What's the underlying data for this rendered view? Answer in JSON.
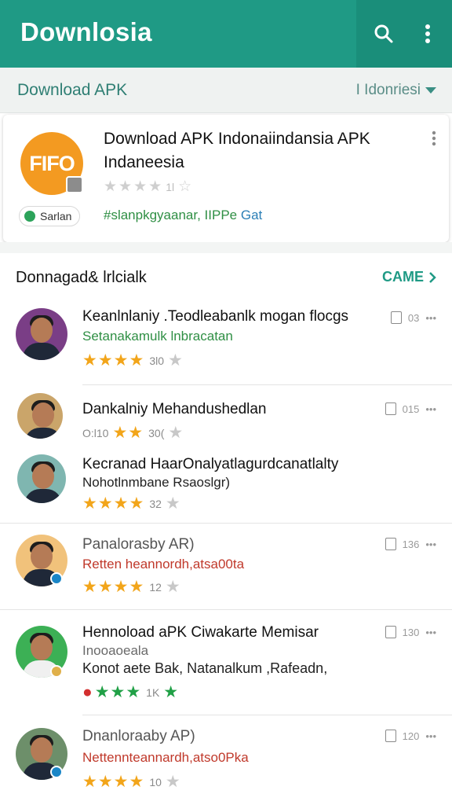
{
  "appbar": {
    "title": "Downlosia"
  },
  "subbar": {
    "title": "Download APK",
    "language": "I Idonriesi"
  },
  "featured": {
    "logo_text": "FIFO",
    "title": "Download APK Indonaiindansia APK Indaneesia",
    "rating_text": "1l",
    "chip_label": "Sarlan",
    "tag1": "#slanpkgyaanar, IIPPe",
    "tag2": " Gat"
  },
  "section": {
    "title": "Donnagad& lrlcialk",
    "link": "CAME"
  },
  "rows": [
    {
      "title": "Keanlnlaniy .Teodleabanlk mogan flocgs",
      "sub": "Setanakamulk lnbracatan",
      "rating": "3l0",
      "meta": "03",
      "avatar": "#7a3e86"
    },
    {
      "title": "Dankalniy Mehandushedlan",
      "sub": "O:l10",
      "rating": "30(",
      "meta": "015",
      "avatar": "#caa56a"
    },
    {
      "title": "Kecranad HaarOnalyatlagurdcanatlalty",
      "sub": "Nohotlnmbane Rsaoslgr)",
      "rating": "32",
      "meta": "",
      "avatar": "#7fb6b0"
    },
    {
      "title": "Panalorasby AR)",
      "sub": "Retten heannordh,atsa00ta",
      "rating": "12",
      "meta": "136",
      "avatar": "#f1c27b"
    },
    {
      "title": "Hennoload aPK Ciwakarte Memisar",
      "sub": "Inooaoeala",
      "sub2": "Konot aete Bak, Natanalkum ,Rafeadn,",
      "rating": "1K",
      "meta": "130",
      "avatar": "#3cb055"
    },
    {
      "title": "Dnanloraaby AP)",
      "sub": "Nettennteannardh,atso0Pka",
      "rating": "10",
      "meta": "120",
      "avatar": "#6d8f6a"
    }
  ]
}
